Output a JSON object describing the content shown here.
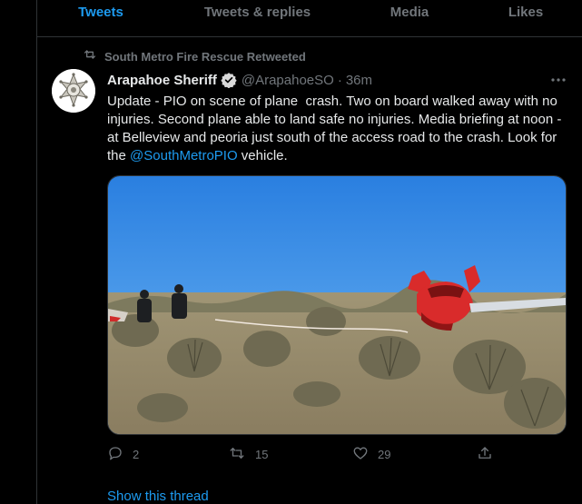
{
  "tabs": [
    "Tweets",
    "Tweets & replies",
    "Media",
    "Likes"
  ],
  "active_tab": "Tweets",
  "retweet_context": "South Metro Fire Rescue Retweeted",
  "tweet": {
    "author_name": "Arapahoe Sheriff",
    "verified": true,
    "handle": "@ArapahoeSO",
    "separator": "·",
    "time": "36m",
    "text_before_mention": "Update - PIO on scene of plane  crash. Two on board walked away with no injuries. Second plane able to land safe no injuries. Media briefing at noon - at Belleview and peoria just south of the access road to the crash. Look for the ",
    "mention": "@SouthMetroPIO",
    "text_after_mention": " vehicle.",
    "media": {
      "description_icon": "photo",
      "colors": {
        "sky": "#2f8de6",
        "plane": "#d92b2b",
        "grass": "#9a8e72"
      }
    }
  },
  "actions": {
    "replies": "2",
    "retweets": "15",
    "likes": "29"
  },
  "show_thread": "Show this thread",
  "colors": {
    "accent": "#1d9bf0",
    "muted": "#71767b",
    "text": "#e7e9ea",
    "border": "#2f3336"
  }
}
